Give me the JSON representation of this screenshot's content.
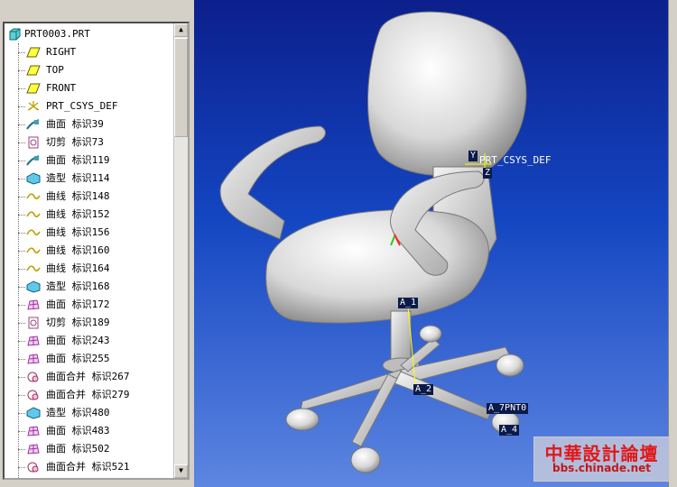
{
  "tree": {
    "root": "PRT0003.PRT",
    "items": [
      {
        "icon": "datum-plane-icon",
        "label": "RIGHT"
      },
      {
        "icon": "datum-plane-icon",
        "label": "TOP"
      },
      {
        "icon": "datum-plane-icon",
        "label": "FRONT"
      },
      {
        "icon": "coordinate-system-icon",
        "label": "PRT_CSYS_DEF"
      },
      {
        "icon": "surface-icon",
        "label": "曲面 标识39"
      },
      {
        "icon": "cut-icon",
        "label": "切剪 标识73"
      },
      {
        "icon": "surface-icon",
        "label": "曲面 标识119"
      },
      {
        "icon": "style-icon",
        "label": "造型 标识114"
      },
      {
        "icon": "curve-icon",
        "label": "曲线 标识148"
      },
      {
        "icon": "curve-icon",
        "label": "曲线 标识152"
      },
      {
        "icon": "curve-icon",
        "label": "曲线 标识156"
      },
      {
        "icon": "curve-icon",
        "label": "曲线 标识160"
      },
      {
        "icon": "curve-icon",
        "label": "曲线 标识164"
      },
      {
        "icon": "style-icon",
        "label": "造型 标识168"
      },
      {
        "icon": "boundary-surface-icon",
        "label": "曲面 标识172"
      },
      {
        "icon": "cut-icon",
        "label": "切剪 标识189"
      },
      {
        "icon": "boundary-surface-icon",
        "label": "曲面 标识243"
      },
      {
        "icon": "boundary-surface-icon",
        "label": "曲面 标识255"
      },
      {
        "icon": "merge-icon",
        "label": "曲面合并 标识267"
      },
      {
        "icon": "merge-icon",
        "label": "曲面合并 标识279"
      },
      {
        "icon": "style-icon",
        "label": "造型 标识480"
      },
      {
        "icon": "boundary-surface-icon",
        "label": "曲面 标识483"
      },
      {
        "icon": "boundary-surface-icon",
        "label": "曲面 标识502"
      },
      {
        "icon": "merge-icon",
        "label": "曲面合并 标识521"
      }
    ]
  },
  "viewport": {
    "csys_label": "PRT_CSYS_DEF",
    "csys_axis_y": "Y",
    "csys_axis_z": "Z",
    "axis_tags": {
      "a1": "A_1",
      "a2": "A_2",
      "a7": "A_7PNT0",
      "a4": "A_4"
    }
  },
  "watermark": {
    "title": "中華設計論壇",
    "url": "bbs.chinade.net"
  },
  "colors": {
    "viewport_top": "#0c1f8c",
    "viewport_bottom": "#5d86e1",
    "watermark_red": "#e01818"
  }
}
